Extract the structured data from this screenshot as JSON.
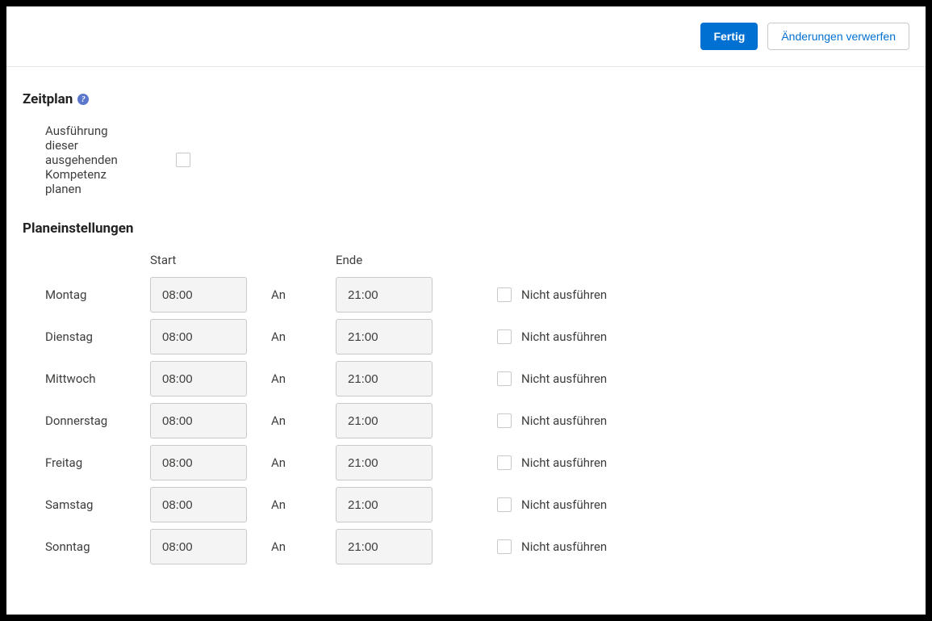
{
  "header": {
    "done_label": "Fertig",
    "discard_label": "Änderungen verwerfen"
  },
  "schedule_section": {
    "title": "Zeitplan",
    "plan_execution_label": "Ausführung dieser ausgehenden Kompetenz planen",
    "settings_title": "Planeinstellungen",
    "col_start": "Start",
    "col_end": "Ende",
    "to_label": "An",
    "no_run_label": "Nicht ausführen",
    "days": [
      {
        "name": "Montag",
        "start": "08:00",
        "end": "21:00"
      },
      {
        "name": "Dienstag",
        "start": "08:00",
        "end": "21:00"
      },
      {
        "name": "Mittwoch",
        "start": "08:00",
        "end": "21:00"
      },
      {
        "name": "Donnerstag",
        "start": "08:00",
        "end": "21:00"
      },
      {
        "name": "Freitag",
        "start": "08:00",
        "end": "21:00"
      },
      {
        "name": "Samstag",
        "start": "08:00",
        "end": "21:00"
      },
      {
        "name": "Sonntag",
        "start": "08:00",
        "end": "21:00"
      }
    ]
  }
}
